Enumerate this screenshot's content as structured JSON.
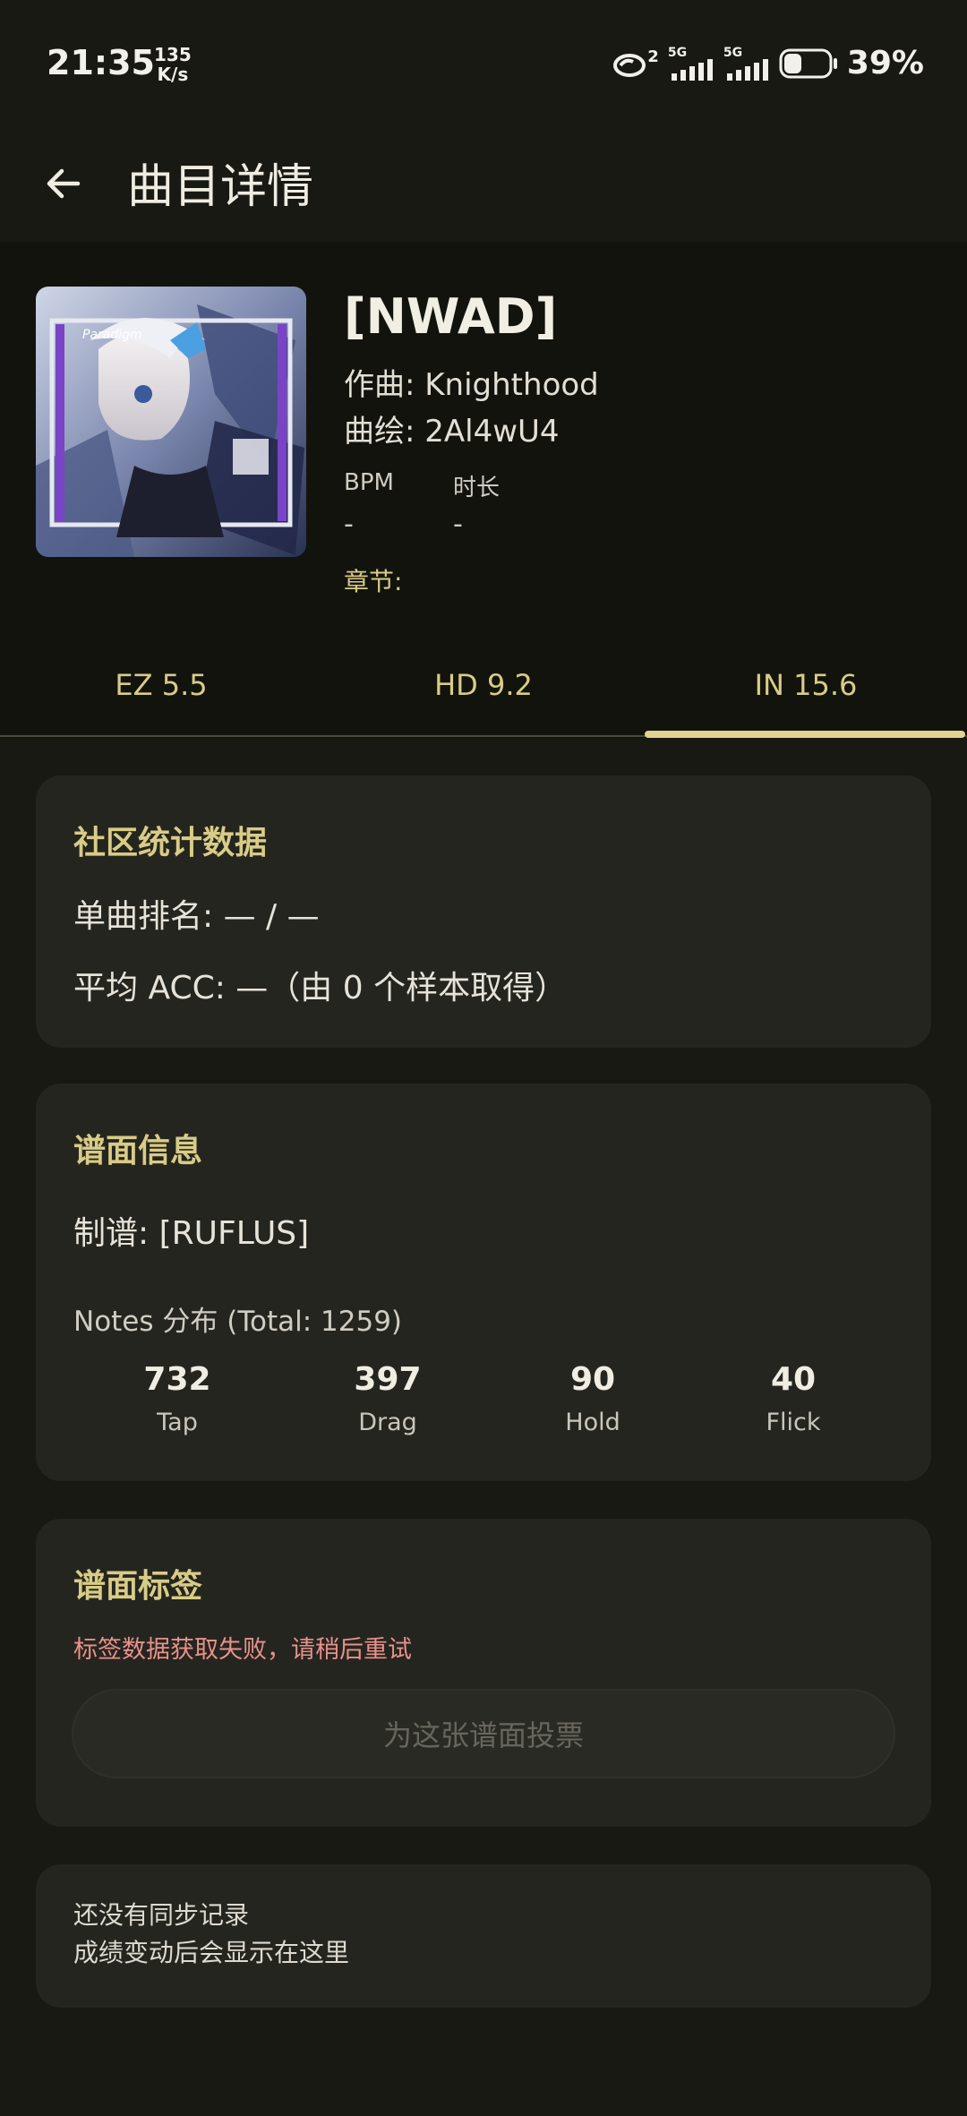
{
  "status_bar": {
    "time": "21:35",
    "net_speed_value": "135",
    "net_speed_unit": "K/s",
    "sim1": "5G",
    "sim2": "5G",
    "hd_badge": "2",
    "battery_percent": "39%",
    "battery_level": 0.39
  },
  "app_bar": {
    "title": "曲目详情",
    "back_icon": "arrow-left-icon"
  },
  "song": {
    "title": "[NWAD]",
    "composer": "作曲: Knighthood",
    "illustrator": "曲绘: 2Al4wU4",
    "bpm_label": "BPM",
    "bpm_value": "-",
    "duration_label": "时长",
    "duration_value": "-",
    "chapter_label": "章节:",
    "cover_caption": "Paradigm"
  },
  "tabs": [
    {
      "label": "EZ 5.5",
      "selected": false
    },
    {
      "label": "HD 9.2",
      "selected": false
    },
    {
      "label": "IN 15.6",
      "selected": true
    }
  ],
  "community_stats": {
    "title": "社区统计数据",
    "rank": "单曲排名: — / —",
    "avg_acc": "平均 ACC: —（由 0 个样本取得）"
  },
  "chart_info": {
    "title": "谱面信息",
    "charter": "制谱: [RUFLUS]",
    "notes_heading": "Notes 分布 (Total: 1259)",
    "notes": [
      {
        "value": "732",
        "label": "Tap"
      },
      {
        "value": "397",
        "label": "Drag"
      },
      {
        "value": "90",
        "label": "Hold"
      },
      {
        "value": "40",
        "label": "Flick"
      }
    ]
  },
  "chart_tags": {
    "title": "谱面标签",
    "error": "标签数据获取失败，请稍后重试",
    "vote_button": "为这张谱面投票"
  },
  "sync": {
    "line1": "还没有同步记录",
    "line2": "成绩变动后会显示在这里"
  },
  "colors": {
    "accent": "#e0d490",
    "accent_text": "#d8cc86",
    "error": "#e8918a",
    "card_bg": "#252520",
    "page_bg": "#13130e"
  }
}
